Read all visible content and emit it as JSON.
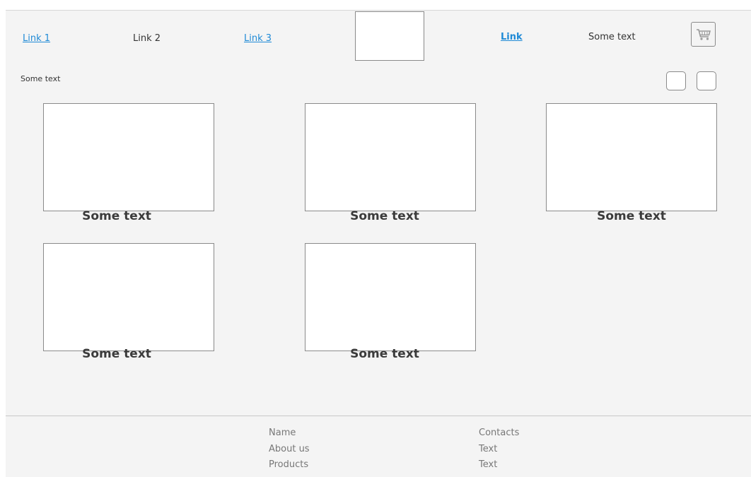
{
  "header": {
    "links": [
      {
        "label": "Link 1",
        "type": "link"
      },
      {
        "label": "Link 2",
        "type": "text"
      },
      {
        "label": "Link 3",
        "type": "link"
      }
    ],
    "link_right": "Link",
    "text_right": "Some text"
  },
  "subheader": {
    "text": "Some text"
  },
  "cards": [
    {
      "label": "Some text"
    },
    {
      "label": "Some text"
    },
    {
      "label": "Some text"
    },
    {
      "label": "Some text"
    },
    {
      "label": "Some text"
    }
  ],
  "footer": {
    "col1": [
      "Name",
      "About us",
      "Products"
    ],
    "col2": [
      "Contacts",
      "Text",
      "Text"
    ]
  },
  "icons": {
    "cart": "shopping-cart-icon"
  },
  "colors": {
    "link": "#1f8ad6",
    "background": "#f4f4f4",
    "border": "#8a8a8a"
  }
}
